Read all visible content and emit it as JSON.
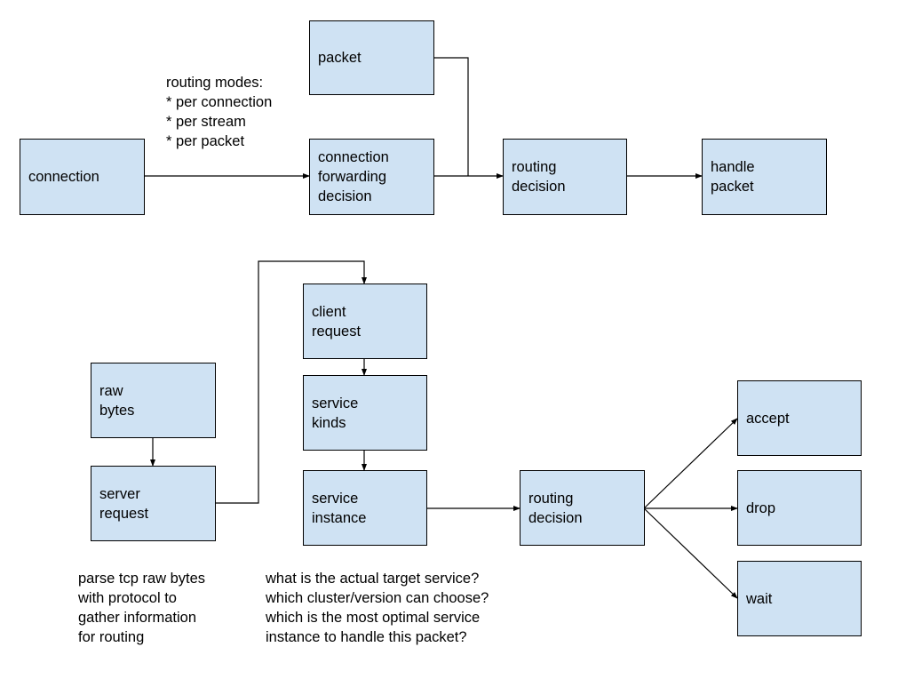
{
  "diagram": {
    "top_flow": {
      "nodes": {
        "connection": "connection",
        "packet": "packet",
        "connection_forwarding_decision": "connection\nforwarding\ndecision",
        "routing_decision": "routing\ndecision",
        "handle_packet": "handle\npacket"
      },
      "annotation": "routing modes:\n* per connection\n* per stream\n* per packet"
    },
    "bottom_flow": {
      "nodes": {
        "raw_bytes": "raw\nbytes",
        "server_request": "server\nrequest",
        "client_request": "client\nrequest",
        "service_kinds": "service\nkinds",
        "service_instance": "service\ninstance",
        "routing_decision": "routing\ndecision",
        "accept": "accept",
        "drop": "drop",
        "wait": "wait"
      },
      "annotations": {
        "parse_note": "parse tcp raw bytes\nwith protocol to\ngather information\nfor routing",
        "questions_note": "what is the actual target service?\nwhich cluster/version can choose?\nwhich is the most optimal service\ninstance to handle this packet?"
      }
    },
    "edges": [
      {
        "from": "connection",
        "to": "connection_forwarding_decision"
      },
      {
        "from": "connection_forwarding_decision",
        "to": "routing_decision"
      },
      {
        "from": "packet",
        "to": "routing_decision"
      },
      {
        "from": "routing_decision",
        "to": "handle_packet"
      },
      {
        "from": "raw_bytes",
        "to": "server_request"
      },
      {
        "from": "server_request",
        "to": "client_request"
      },
      {
        "from": "client_request",
        "to": "service_kinds"
      },
      {
        "from": "service_kinds",
        "to": "service_instance"
      },
      {
        "from": "service_instance",
        "to": "routing_decision_2"
      },
      {
        "from": "routing_decision_2",
        "to": "accept"
      },
      {
        "from": "routing_decision_2",
        "to": "drop"
      },
      {
        "from": "routing_decision_2",
        "to": "wait"
      }
    ],
    "colors": {
      "node_fill": "#cfe2f3",
      "node_border": "#000000",
      "edge": "#000000"
    }
  }
}
